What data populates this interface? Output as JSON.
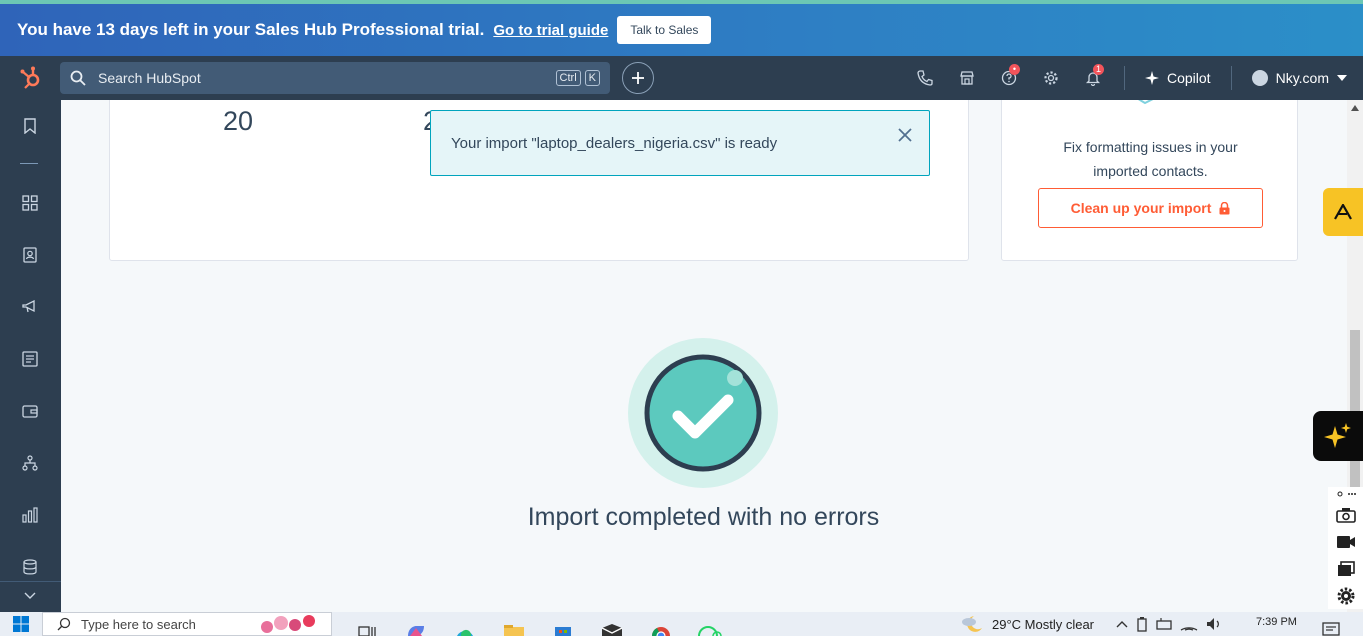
{
  "trial_banner": {
    "message": "You have 13 days left in your Sales Hub Professional trial.",
    "guide_link": "Go to trial guide",
    "sales_button": "Talk to Sales"
  },
  "topnav": {
    "search_placeholder": "Search HubSpot",
    "shortcut_key1": "Ctrl",
    "shortcut_key2": "K",
    "notifications_count": "1",
    "copilot_label": "Copilot",
    "account_name": "Nky.com"
  },
  "stats": {
    "left_value": "20",
    "right_value_partial": "2"
  },
  "toast": {
    "message": "Your import \"laptop_dealers_nigeria.csv\" is ready"
  },
  "cleanup_card": {
    "description": "Fix formatting issues in your imported contacts.",
    "button_label": "Clean up your import"
  },
  "status": {
    "message": "Import completed with no errors"
  },
  "taskbar": {
    "search_placeholder": "Type here to search",
    "weather": "29°C  Mostly clear",
    "time": "7:39 PM"
  },
  "colors": {
    "accent": "#ff5c35",
    "nav_bg": "#2d3e50",
    "success_teal": "#5cc9be",
    "toast_border": "#00a4bd"
  }
}
